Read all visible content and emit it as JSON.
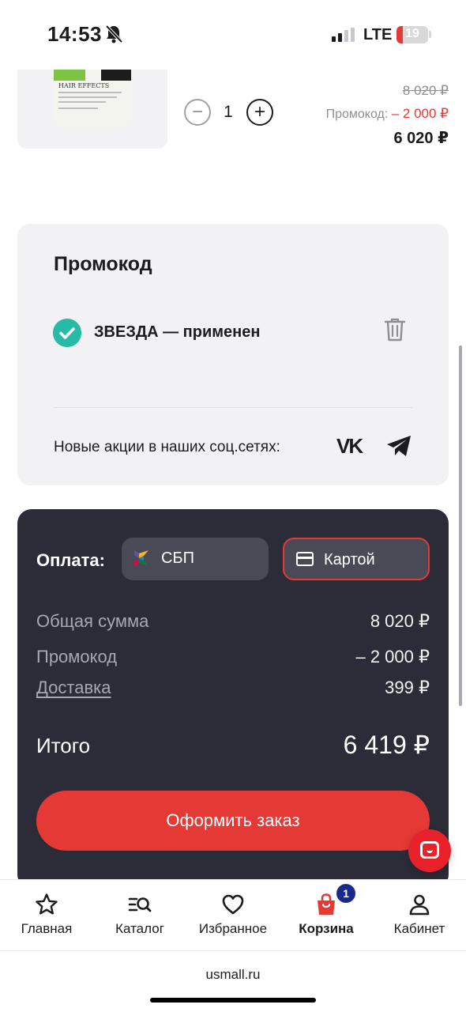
{
  "status_bar": {
    "time": "14:53",
    "network": "LTE",
    "battery": "19",
    "battery_level": 0.19
  },
  "product": {
    "image_brand_text": "HAIR EFFECTS",
    "quantity": "1",
    "old_price": "8 020 ₽",
    "promo_label": "Промокод:",
    "promo_discount": "– 2 000 ₽",
    "price": "6 020 ₽"
  },
  "promo": {
    "title": "Промокод",
    "applied_text": "ЗВЕЗДА — применен",
    "social_text": "Новые акции в наших соц.сетях:",
    "vk_label": "VK"
  },
  "payment": {
    "label": "Оплата:",
    "options": [
      {
        "label": "СБП",
        "selected": false
      },
      {
        "label": "Картой",
        "selected": true
      }
    ],
    "rows": [
      {
        "label": "Общая сумма",
        "value": "8 020 ₽"
      },
      {
        "label": "Промокод",
        "value": "– 2 000 ₽"
      },
      {
        "label": "Доставка",
        "value": "399 ₽"
      }
    ],
    "total_label": "Итого",
    "total_value": "6 419 ₽",
    "order_button": "Оформить заказ"
  },
  "nav": {
    "items": [
      {
        "label": "Главная",
        "icon": "star-icon"
      },
      {
        "label": "Каталог",
        "icon": "catalog-search-icon"
      },
      {
        "label": "Избранное",
        "icon": "heart-icon"
      },
      {
        "label": "Корзина",
        "icon": "cart-bag-icon",
        "badge": "1",
        "active": true
      },
      {
        "label": "Кабинет",
        "icon": "user-icon"
      }
    ]
  },
  "browser": {
    "url": "usmall.ru"
  },
  "colors": {
    "accent_red": "#e53935",
    "success_teal": "#26bba6",
    "dark_panel": "#2c2c38",
    "badge_blue": "#1a2a8c"
  }
}
